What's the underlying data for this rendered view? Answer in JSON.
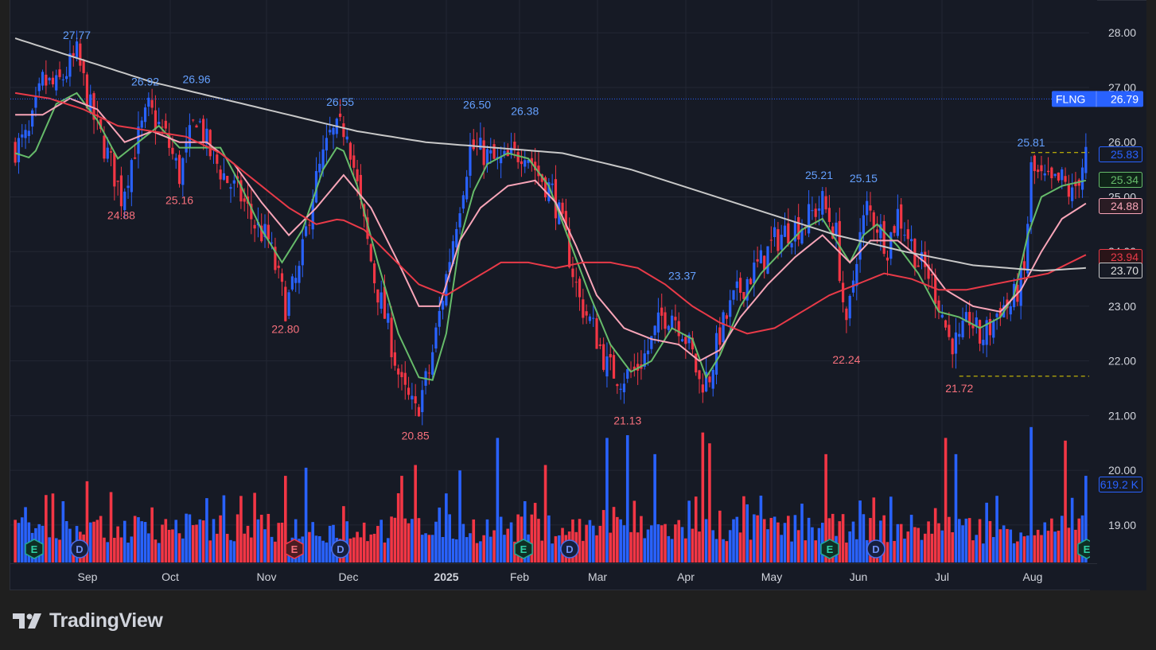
{
  "brand": {
    "name": "TradingView"
  },
  "colors": {
    "background": "#161a25",
    "grid": "#232734",
    "up": "#2962ff",
    "down": "#f23645",
    "ma_green": "#66bb6a",
    "ma_pink": "#f8a5b8",
    "ma_red": "#e83a48",
    "ma_gray": "#c8c8c8",
    "axis_text": "#d1d4dc",
    "high_label": "#64a0ff",
    "low_label": "#f7707c",
    "ticker_badge": "#2962ff",
    "level_line": "#e5d300"
  },
  "chart_data": {
    "type": "candlestick",
    "symbol": "FLNG",
    "last_price": "26.79",
    "ylim": [
      18.3,
      28.6
    ],
    "y_ticks": [
      "28.00",
      "27.00",
      "26.00",
      "25.00",
      "24.00",
      "23.00",
      "22.00",
      "21.00",
      "20.00",
      "19.00"
    ],
    "x_ticks": [
      "Sep",
      "Oct",
      "Nov",
      "Dec",
      "2025",
      "Feb",
      "Mar",
      "Apr",
      "May",
      "Jun",
      "Jul",
      "Aug"
    ],
    "x_ticks_bold": [
      "2025"
    ],
    "high_labels": [
      {
        "text": "27.77",
        "bar": 18
      },
      {
        "text": "26.92",
        "bar": 38
      },
      {
        "text": "26.96",
        "bar": 53
      },
      {
        "text": "26.55",
        "bar": 95
      },
      {
        "text": "26.50",
        "bar": 135
      },
      {
        "text": "26.38",
        "bar": 149
      },
      {
        "text": "23.37",
        "bar": 195
      },
      {
        "text": "25.21",
        "bar": 235
      },
      {
        "text": "25.15",
        "bar": 248
      },
      {
        "text": "25.81",
        "bar": 297
      }
    ],
    "low_labels": [
      {
        "text": "24.88",
        "bar": 31
      },
      {
        "text": "25.16",
        "bar": 48
      },
      {
        "text": "22.80",
        "bar": 79
      },
      {
        "text": "20.85",
        "bar": 117
      },
      {
        "text": "21.13",
        "bar": 179
      },
      {
        "text": "22.24",
        "bar": 243
      },
      {
        "text": "21.72",
        "bar": 276
      }
    ],
    "price_badges": [
      {
        "value": "25.83",
        "style": "outline",
        "color": "#2962ff"
      },
      {
        "value": "25.34",
        "style": "outline",
        "color": "#66bb6a"
      },
      {
        "value": "24.88",
        "style": "outline",
        "color": "#f8a5b8"
      },
      {
        "value": "23.94",
        "style": "outline",
        "color": "#e83a48"
      },
      {
        "value": "23.70",
        "style": "outline",
        "color": "#c8c8c8"
      },
      {
        "value": "619.2 K",
        "style": "outline",
        "color": "#2962ff"
      }
    ],
    "events": [
      {
        "type": "E",
        "kind": "earnings-reported"
      },
      {
        "type": "D",
        "kind": "dividend"
      },
      {
        "type": "E",
        "kind": "earnings-missed"
      },
      {
        "type": "D",
        "kind": "dividend"
      },
      {
        "type": "E",
        "kind": "earnings-reported"
      },
      {
        "type": "D",
        "kind": "dividend"
      },
      {
        "type": "E",
        "kind": "earnings-reported"
      },
      {
        "type": "D",
        "kind": "dividend"
      },
      {
        "type": "E",
        "kind": "earnings-reported"
      }
    ],
    "price_path": [
      [
        0,
        25.9
      ],
      [
        4,
        26.1
      ],
      [
        8,
        27.1
      ],
      [
        12,
        27.0
      ],
      [
        18,
        27.6
      ],
      [
        22,
        26.6
      ],
      [
        28,
        25.6
      ],
      [
        31,
        25.0
      ],
      [
        35,
        25.9
      ],
      [
        39,
        26.6
      ],
      [
        44,
        26.1
      ],
      [
        48,
        25.4
      ],
      [
        53,
        26.5
      ],
      [
        57,
        25.8
      ],
      [
        62,
        25.3
      ],
      [
        66,
        25.0
      ],
      [
        70,
        24.5
      ],
      [
        74,
        24.2
      ],
      [
        79,
        23.0
      ],
      [
        83,
        23.6
      ],
      [
        87,
        25.1
      ],
      [
        92,
        26.1
      ],
      [
        97,
        26.3
      ],
      [
        101,
        24.8
      ],
      [
        105,
        23.5
      ],
      [
        109,
        22.6
      ],
      [
        113,
        21.5
      ],
      [
        117,
        21.05
      ],
      [
        121,
        21.8
      ],
      [
        125,
        23.2
      ],
      [
        129,
        24.6
      ],
      [
        133,
        25.9
      ],
      [
        137,
        25.8
      ],
      [
        141,
        25.6
      ],
      [
        145,
        25.7
      ],
      [
        149,
        25.9
      ],
      [
        153,
        25.4
      ],
      [
        157,
        25.1
      ],
      [
        161,
        24.2
      ],
      [
        165,
        23.1
      ],
      [
        169,
        22.6
      ],
      [
        173,
        21.9
      ],
      [
        177,
        21.7
      ],
      [
        181,
        21.8
      ],
      [
        185,
        22.2
      ],
      [
        189,
        22.8
      ],
      [
        192,
        22.9
      ],
      [
        195,
        22.6
      ],
      [
        198,
        22.1
      ],
      [
        200,
        21.6
      ],
      [
        203,
        21.75
      ],
      [
        206,
        22.5
      ],
      [
        210,
        23.1
      ],
      [
        214,
        23.5
      ],
      [
        218,
        23.8
      ],
      [
        222,
        24.2
      ],
      [
        226,
        24.4
      ],
      [
        230,
        24.5
      ],
      [
        233,
        24.7
      ],
      [
        236,
        24.9
      ],
      [
        240,
        24.3
      ],
      [
        243,
        22.5
      ],
      [
        246,
        24.0
      ],
      [
        249,
        24.8
      ],
      [
        252,
        24.5
      ],
      [
        255,
        24.1
      ],
      [
        258,
        24.7
      ],
      [
        261,
        24.3
      ],
      [
        264,
        23.8
      ],
      [
        267,
        23.6
      ],
      [
        270,
        23.1
      ],
      [
        273,
        22.4
      ],
      [
        276,
        22.3
      ],
      [
        279,
        22.8
      ],
      [
        282,
        22.4
      ],
      [
        285,
        22.6
      ],
      [
        288,
        23.0
      ],
      [
        291,
        23.0
      ],
      [
        293,
        23.3
      ],
      [
        295,
        23.6
      ],
      [
        297,
        25.5
      ],
      [
        300,
        25.3
      ],
      [
        303,
        25.2
      ],
      [
        306,
        25.3
      ],
      [
        309,
        25.0
      ],
      [
        311,
        25.4
      ],
      [
        313,
        25.8
      ]
    ],
    "moving_averages": [
      {
        "color": "#66bb6a",
        "points": [
          [
            0,
            25.8
          ],
          [
            5,
            25.7
          ],
          [
            12,
            26.7
          ],
          [
            18,
            26.9
          ],
          [
            24,
            26.4
          ],
          [
            30,
            25.7
          ],
          [
            36,
            26.0
          ],
          [
            42,
            26.3
          ],
          [
            48,
            25.9
          ],
          [
            54,
            25.9
          ],
          [
            60,
            25.9
          ],
          [
            66,
            25.2
          ],
          [
            72,
            24.4
          ],
          [
            78,
            23.8
          ],
          [
            84,
            24.4
          ],
          [
            90,
            25.5
          ],
          [
            95,
            26.0
          ],
          [
            100,
            25.2
          ],
          [
            106,
            23.8
          ],
          [
            112,
            22.5
          ],
          [
            118,
            21.7
          ],
          [
            122,
            21.65
          ],
          [
            126,
            22.5
          ],
          [
            130,
            24.2
          ],
          [
            134,
            25.1
          ],
          [
            138,
            25.6
          ],
          [
            144,
            25.8
          ],
          [
            150,
            25.7
          ],
          [
            156,
            25.2
          ],
          [
            162,
            24.2
          ],
          [
            168,
            23.2
          ],
          [
            174,
            22.3
          ],
          [
            180,
            21.8
          ],
          [
            186,
            22.0
          ],
          [
            192,
            22.6
          ],
          [
            198,
            22.4
          ],
          [
            202,
            21.7
          ],
          [
            206,
            22.1
          ],
          [
            212,
            23.0
          ],
          [
            218,
            23.6
          ],
          [
            224,
            24.0
          ],
          [
            230,
            24.4
          ],
          [
            236,
            24.6
          ],
          [
            240,
            24.2
          ],
          [
            244,
            23.8
          ],
          [
            248,
            24.3
          ],
          [
            252,
            24.5
          ],
          [
            258,
            24.1
          ],
          [
            264,
            23.6
          ],
          [
            270,
            22.9
          ],
          [
            276,
            22.8
          ],
          [
            282,
            22.6
          ],
          [
            288,
            22.8
          ],
          [
            292,
            23.2
          ],
          [
            296,
            24.3
          ],
          [
            300,
            25.0
          ],
          [
            306,
            25.2
          ],
          [
            313,
            25.3
          ]
        ]
      },
      {
        "color": "#f8a5b8",
        "points": [
          [
            0,
            26.5
          ],
          [
            8,
            26.5
          ],
          [
            16,
            26.8
          ],
          [
            24,
            26.6
          ],
          [
            32,
            26.0
          ],
          [
            40,
            26.2
          ],
          [
            48,
            26.0
          ],
          [
            56,
            26.0
          ],
          [
            64,
            25.6
          ],
          [
            72,
            24.9
          ],
          [
            80,
            24.3
          ],
          [
            88,
            24.8
          ],
          [
            96,
            25.4
          ],
          [
            104,
            24.8
          ],
          [
            112,
            23.8
          ],
          [
            118,
            23.0
          ],
          [
            124,
            23.0
          ],
          [
            130,
            24.2
          ],
          [
            136,
            24.8
          ],
          [
            144,
            25.2
          ],
          [
            152,
            25.3
          ],
          [
            158,
            24.9
          ],
          [
            164,
            24.1
          ],
          [
            170,
            23.2
          ],
          [
            178,
            22.6
          ],
          [
            186,
            22.4
          ],
          [
            194,
            22.3
          ],
          [
            200,
            22.0
          ],
          [
            206,
            22.2
          ],
          [
            212,
            22.8
          ],
          [
            220,
            23.4
          ],
          [
            228,
            23.9
          ],
          [
            236,
            24.3
          ],
          [
            244,
            23.8
          ],
          [
            250,
            24.2
          ],
          [
            258,
            24.2
          ],
          [
            266,
            23.8
          ],
          [
            272,
            23.3
          ],
          [
            280,
            23.0
          ],
          [
            288,
            22.9
          ],
          [
            294,
            23.3
          ],
          [
            300,
            24.0
          ],
          [
            306,
            24.6
          ],
          [
            313,
            24.88
          ]
        ]
      },
      {
        "color": "#e83a48",
        "points": [
          [
            0,
            26.9
          ],
          [
            10,
            26.8
          ],
          [
            20,
            26.6
          ],
          [
            30,
            26.3
          ],
          [
            40,
            26.2
          ],
          [
            50,
            26.1
          ],
          [
            60,
            25.8
          ],
          [
            70,
            25.3
          ],
          [
            80,
            24.8
          ],
          [
            88,
            24.5
          ],
          [
            95,
            24.6
          ],
          [
            102,
            24.4
          ],
          [
            110,
            23.9
          ],
          [
            118,
            23.4
          ],
          [
            126,
            23.2
          ],
          [
            134,
            23.5
          ],
          [
            142,
            23.8
          ],
          [
            150,
            23.8
          ],
          [
            158,
            23.7
          ],
          [
            166,
            23.8
          ],
          [
            174,
            23.8
          ],
          [
            182,
            23.7
          ],
          [
            190,
            23.4
          ],
          [
            198,
            23.0
          ],
          [
            206,
            22.7
          ],
          [
            214,
            22.5
          ],
          [
            222,
            22.6
          ],
          [
            230,
            22.9
          ],
          [
            238,
            23.2
          ],
          [
            246,
            23.4
          ],
          [
            254,
            23.6
          ],
          [
            262,
            23.5
          ],
          [
            270,
            23.3
          ],
          [
            278,
            23.3
          ],
          [
            286,
            23.4
          ],
          [
            294,
            23.5
          ],
          [
            302,
            23.6
          ],
          [
            313,
            23.94
          ]
        ]
      },
      {
        "color": "#c8c8c8",
        "points": [
          [
            0,
            27.9
          ],
          [
            20,
            27.5
          ],
          [
            40,
            27.1
          ],
          [
            60,
            26.8
          ],
          [
            80,
            26.5
          ],
          [
            100,
            26.2
          ],
          [
            120,
            26.0
          ],
          [
            140,
            25.9
          ],
          [
            160,
            25.8
          ],
          [
            180,
            25.5
          ],
          [
            200,
            25.1
          ],
          [
            220,
            24.7
          ],
          [
            240,
            24.3
          ],
          [
            260,
            24.0
          ],
          [
            280,
            23.75
          ],
          [
            300,
            23.65
          ],
          [
            313,
            23.7
          ]
        ]
      }
    ],
    "volume_ylim": [
      0,
      260000
    ],
    "volume_spikes": [
      [
        21,
        150000
      ],
      [
        79,
        160000
      ],
      [
        85,
        175000
      ],
      [
        113,
        160000
      ],
      [
        117,
        180000
      ],
      [
        130,
        170000
      ],
      [
        141,
        230000
      ],
      [
        155,
        180000
      ],
      [
        173,
        230000
      ],
      [
        179,
        235000
      ],
      [
        187,
        200000
      ],
      [
        201,
        240000
      ],
      [
        203,
        220000
      ],
      [
        237,
        200000
      ],
      [
        272,
        230000
      ],
      [
        275,
        200000
      ],
      [
        297,
        250000
      ],
      [
        307,
        225000
      ],
      [
        313,
        160000
      ]
    ]
  }
}
